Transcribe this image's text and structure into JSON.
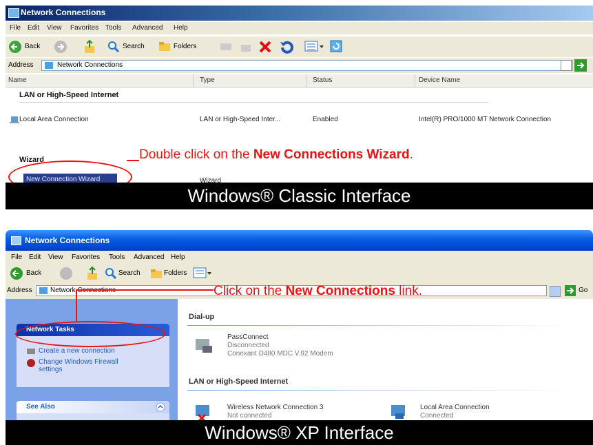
{
  "top": {
    "title": "Network Connections",
    "menu": [
      "File",
      "Edit",
      "View",
      "Favorites",
      "Tools",
      "Advanced",
      "Help"
    ],
    "toolbar": {
      "back": "Back",
      "search": "Search",
      "folders": "Folders"
    },
    "address_label": "Address",
    "address_value": "Network Connections",
    "columns": [
      "Name",
      "Type",
      "Status",
      "Device Name"
    ],
    "group_lan": "LAN or High-Speed Internet",
    "row": {
      "name": "Local Area Connection",
      "type": "LAN or High-Speed Inter...",
      "status": "Enabled",
      "device": "Intel(R) PRO/1000 MT Network Connection"
    },
    "group_wizard": "Wizard",
    "wizard_item": "New Connection Wizard",
    "wizard_type": "Wizard",
    "callout": {
      "prefix": "Double click on the ",
      "bold": "New Connections Wizard",
      "suffix": "."
    },
    "banner": "Windows® Classic Interface"
  },
  "bottom": {
    "title": "Network Connections",
    "menu": [
      "File",
      "Edit",
      "View",
      "Favorites",
      "Tools",
      "Advanced",
      "Help"
    ],
    "toolbar": {
      "back": "Back",
      "search": "Search",
      "folders": "Folders"
    },
    "address_label": "Address",
    "address_value": "Network Connections",
    "go": "Go",
    "tasks_header": "Network Tasks",
    "task_create": "Create a new connection",
    "task_firewall": "Change Windows Firewall settings",
    "see_also": "See Also",
    "group_dialup": "Dial-up",
    "dialup": {
      "name": "PassConnect",
      "status": "Disconnected",
      "device": "Conexant D480 MDC V.92 Modem"
    },
    "group_lan": "LAN or High-Speed Internet",
    "wireless": {
      "name": "Wireless Network Connection 3",
      "status": "Not connected"
    },
    "lan": {
      "name": "Local Area Connection",
      "status": "Connected"
    },
    "callout": {
      "prefix": "Click on the ",
      "bold": "New Connections",
      "suffix": " link."
    },
    "banner": "Windows® XP Interface"
  },
  "colors": {
    "annotation": "#ee1111",
    "xp_title": "#0a5fe0",
    "classic_title": "#0a246a",
    "banner": "#000000"
  }
}
